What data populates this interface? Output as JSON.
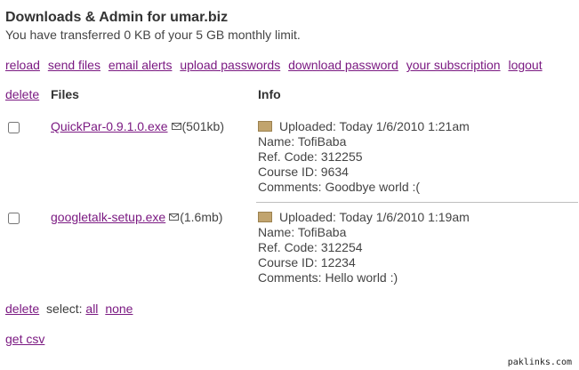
{
  "header": {
    "title": "Downloads & Admin for umar.biz",
    "subtitle": "You have transferred 0 KB of your 5 GB monthly limit."
  },
  "nav": [
    "reload",
    "send files",
    "email alerts",
    "upload passwords",
    "download password",
    "your subscription",
    "logout"
  ],
  "table": {
    "delete_label": "delete",
    "files_header": "Files",
    "info_header": "Info",
    "rows": [
      {
        "filename": "QuickPar-0.9.1.0.exe",
        "size": "(501kb)",
        "uploaded": "Uploaded: Today 1/6/2010 1:21am",
        "name": "Name: TofiBaba",
        "ref": "Ref. Code: 312255",
        "course": "Course ID: 9634",
        "comments": "Comments: Goodbye world :("
      },
      {
        "filename": "googletalk-setup.exe",
        "size": "(1.6mb)",
        "uploaded": "Uploaded: Today 1/6/2010 1:19am",
        "name": "Name: TofiBaba",
        "ref": "Ref. Code: 312254",
        "course": "Course ID: 12234",
        "comments": "Comments: Hello world :)"
      }
    ]
  },
  "footer": {
    "delete_label": "delete",
    "select_label": "select:",
    "all_label": "all",
    "none_label": "none",
    "csv_label": "get csv"
  },
  "watermark": "paklinks.com",
  "colors": {
    "link": "#7b1a82",
    "text": "#3c3c3c",
    "folder": "#c1a46e"
  },
  "icons": {
    "mail": "envelope-icon",
    "file": "folder-icon"
  }
}
